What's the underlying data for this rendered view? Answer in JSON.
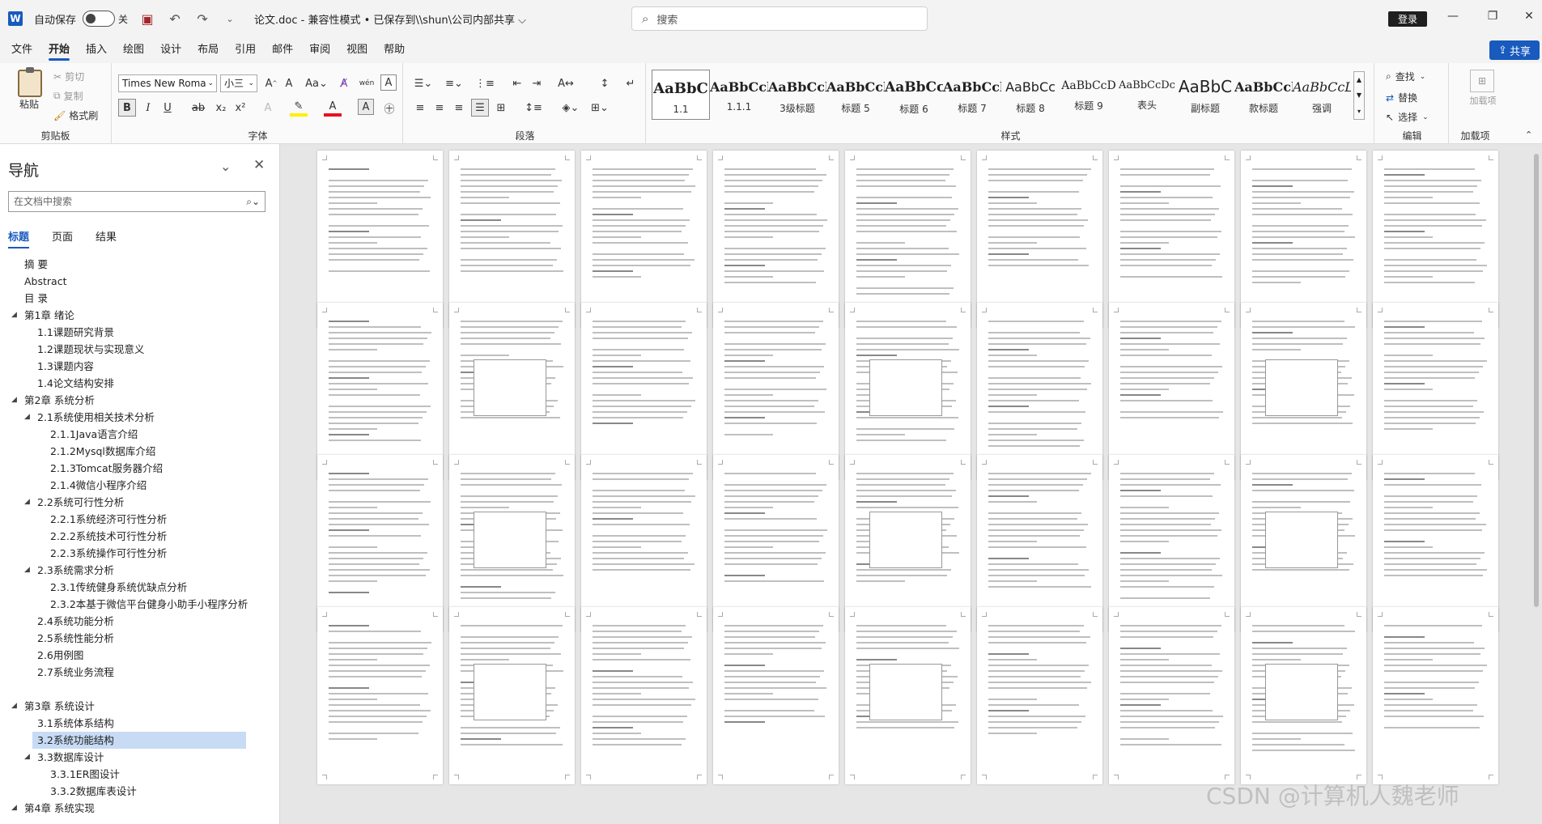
{
  "titlebar": {
    "autosave_label": "自动保存",
    "autosave_state": "关",
    "doc_title": "论文.doc  -  兼容性模式 • 已保存到\\\\shun\\公司内部共享 ⌵",
    "search_placeholder": "搜索",
    "login_label": "登录"
  },
  "menu": {
    "tabs": [
      "文件",
      "开始",
      "插入",
      "绘图",
      "设计",
      "布局",
      "引用",
      "邮件",
      "审阅",
      "视图",
      "帮助"
    ],
    "share_label": "共享"
  },
  "ribbon": {
    "clipboard": {
      "paste": "粘贴",
      "cut": "剪切",
      "copy": "复制",
      "format_painter": "格式刷",
      "label": "剪贴板"
    },
    "font": {
      "font_name": "Times New Roma",
      "font_size": "小三",
      "label": "字体"
    },
    "paragraph": {
      "label": "段落"
    },
    "styles": {
      "label": "样式",
      "items": [
        {
          "preview": "AaBbC",
          "name": "1.1"
        },
        {
          "preview": "AaBbCcl",
          "name": "1.1.1"
        },
        {
          "preview": "AaBbCcl",
          "name": "3级标题"
        },
        {
          "preview": "AaBbCcl",
          "name": "标题 5"
        },
        {
          "preview": "AaBbCc",
          "name": "标题 6"
        },
        {
          "preview": "AaBbCcl",
          "name": "标题 7"
        },
        {
          "preview": "AaBbCc",
          "name": "标题 8"
        },
        {
          "preview": "AaBbCcD",
          "name": "标题 9"
        },
        {
          "preview": "AaBbCcDc",
          "name": "表头"
        },
        {
          "preview": "AaBbC",
          "name": "副标题"
        },
        {
          "preview": "AaBbCcl",
          "name": "款标题"
        },
        {
          "preview": "AaBbCcL",
          "name": "强调"
        }
      ]
    },
    "editing": {
      "find": "查找",
      "replace": "替换",
      "select": "选择",
      "label": "编辑"
    },
    "addins": {
      "add": "加载项",
      "label": "加载项"
    }
  },
  "nav": {
    "title": "导航",
    "search_placeholder": "在文档中搜索",
    "tabs": [
      "标题",
      "页面",
      "结果"
    ],
    "items": [
      {
        "text": "摘  要",
        "level": 0,
        "tri": ""
      },
      {
        "text": "Abstract",
        "level": 0,
        "tri": ""
      },
      {
        "text": "目  录",
        "level": 0,
        "tri": ""
      },
      {
        "text": "第1章 绪论",
        "level": 0,
        "tri": "◢"
      },
      {
        "text": "1.1课题研究背景",
        "level": 1,
        "tri": ""
      },
      {
        "text": "1.2课题现状与实现意义",
        "level": 1,
        "tri": ""
      },
      {
        "text": "1.3课题内容",
        "level": 1,
        "tri": ""
      },
      {
        "text": "1.4论文结构安排",
        "level": 1,
        "tri": ""
      },
      {
        "text": "第2章 系统分析",
        "level": 0,
        "tri": "◢"
      },
      {
        "text": "2.1系统使用相关技术分析",
        "level": 1,
        "tri": "◢"
      },
      {
        "text": "2.1.1Java语言介绍",
        "level": 2,
        "tri": ""
      },
      {
        "text": "2.1.2Mysql数据库介绍",
        "level": 2,
        "tri": ""
      },
      {
        "text": "2.1.3Tomcat服务器介绍",
        "level": 2,
        "tri": ""
      },
      {
        "text": "2.1.4微信小程序介绍",
        "level": 2,
        "tri": ""
      },
      {
        "text": "2.2系统可行性分析",
        "level": 1,
        "tri": "◢"
      },
      {
        "text": "2.2.1系统经济可行性分析",
        "level": 2,
        "tri": ""
      },
      {
        "text": "2.2.2系统技术可行性分析",
        "level": 2,
        "tri": ""
      },
      {
        "text": "2.2.3系统操作可行性分析",
        "level": 2,
        "tri": ""
      },
      {
        "text": "2.3系统需求分析",
        "level": 1,
        "tri": "◢"
      },
      {
        "text": "2.3.1传统健身系统优缺点分析",
        "level": 2,
        "tri": ""
      },
      {
        "text": "2.3.2本基于微信平台健身小助手小程序分析",
        "level": 2,
        "tri": ""
      },
      {
        "text": "2.4系统功能分析",
        "level": 1,
        "tri": ""
      },
      {
        "text": "2.5系统性能分析",
        "level": 1,
        "tri": ""
      },
      {
        "text": "2.6用例图",
        "level": 1,
        "tri": ""
      },
      {
        "text": "2.7系统业务流程",
        "level": 1,
        "tri": ""
      },
      {
        "text": "",
        "level": 1,
        "tri": ""
      },
      {
        "text": "第3章 系统设计",
        "level": 0,
        "tri": "◢"
      },
      {
        "text": "3.1系统体系结构",
        "level": 1,
        "tri": ""
      },
      {
        "text": "3.2系统功能结构",
        "level": 1,
        "tri": "",
        "selected": true
      },
      {
        "text": "3.3数据库设计",
        "level": 1,
        "tri": "◢"
      },
      {
        "text": "3.3.1ER图设计",
        "level": 2,
        "tri": ""
      },
      {
        "text": "3.3.2数据库表设计",
        "level": 2,
        "tri": ""
      },
      {
        "text": "第4章 系统实现",
        "level": 0,
        "tri": "◢"
      }
    ]
  },
  "watermark": "CSDN @计算机人魏老师"
}
